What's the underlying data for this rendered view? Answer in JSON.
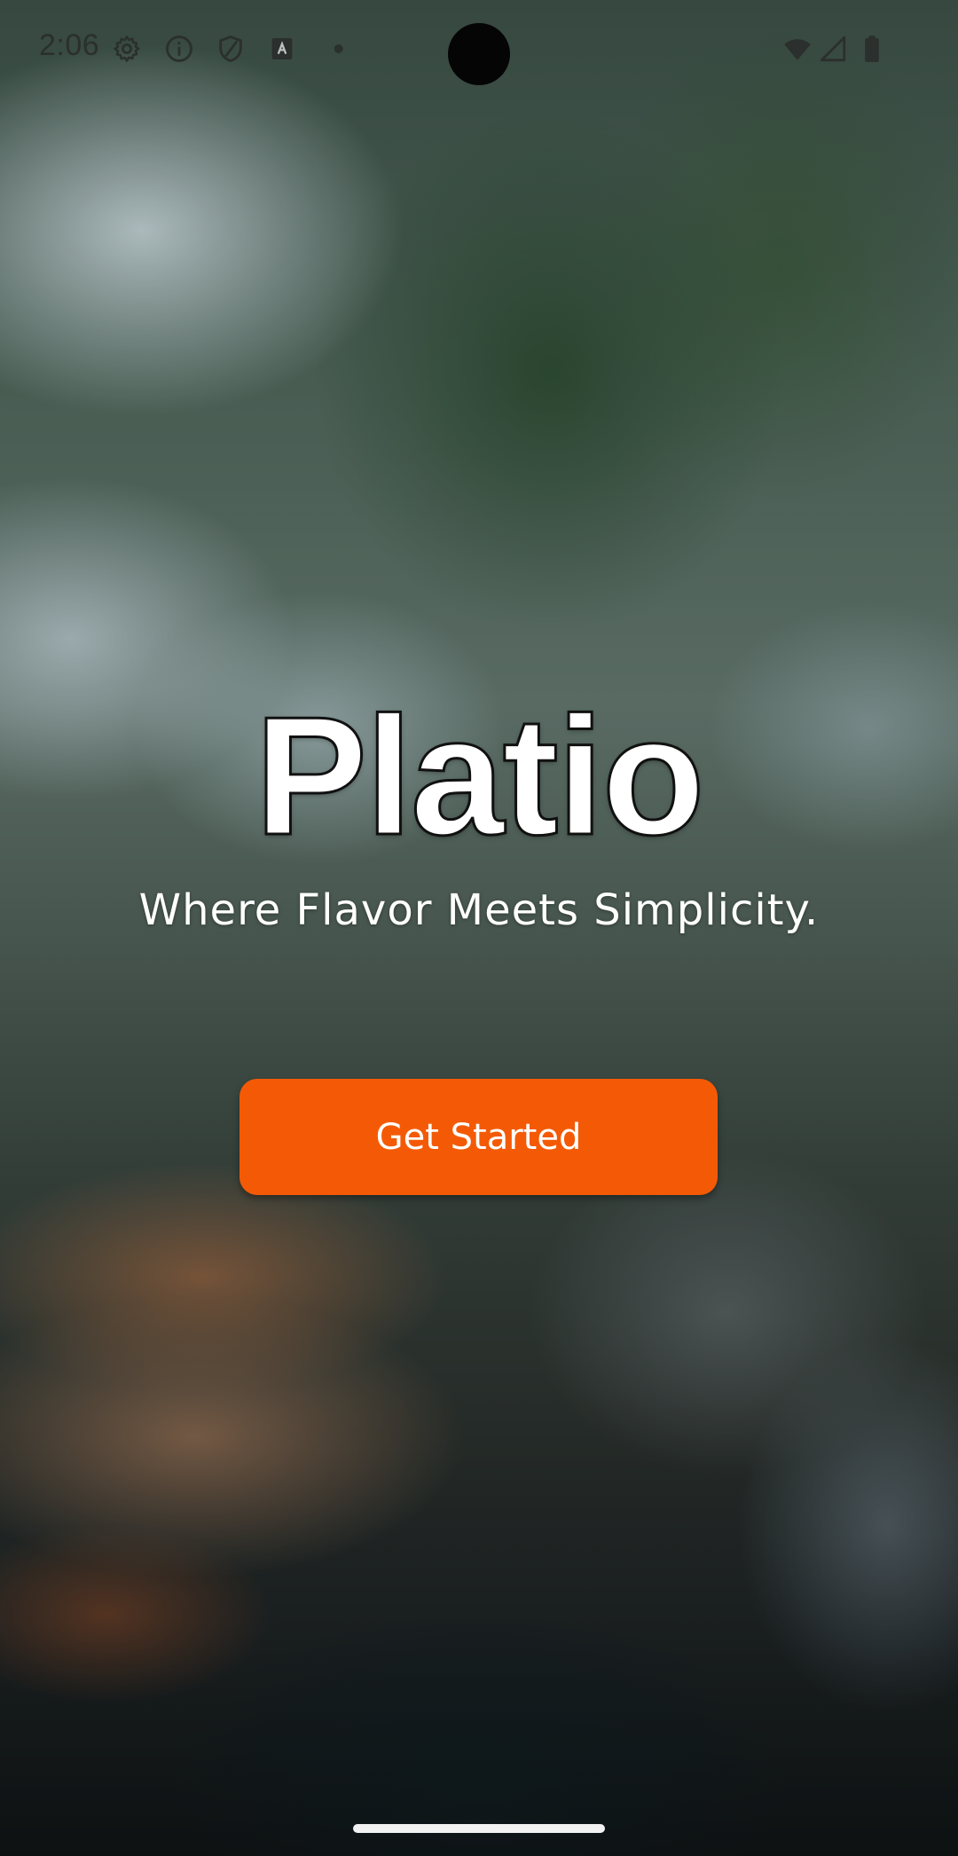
{
  "status_bar": {
    "time": "2:06",
    "left_icons": [
      "gear-icon",
      "info-icon",
      "shield-icon",
      "keyboard-icon",
      "dot-icon"
    ],
    "right_icons": [
      "wifi-icon",
      "signal-icon",
      "battery-icon"
    ]
  },
  "hero": {
    "title": "Platio",
    "tagline": "Where Flavor Meets Simplicity."
  },
  "cta": {
    "label": "Get Started"
  },
  "colors": {
    "accent": "#F45A05",
    "text_on_image": "#FFFFFF",
    "status_icons": "#2B2F2D"
  }
}
